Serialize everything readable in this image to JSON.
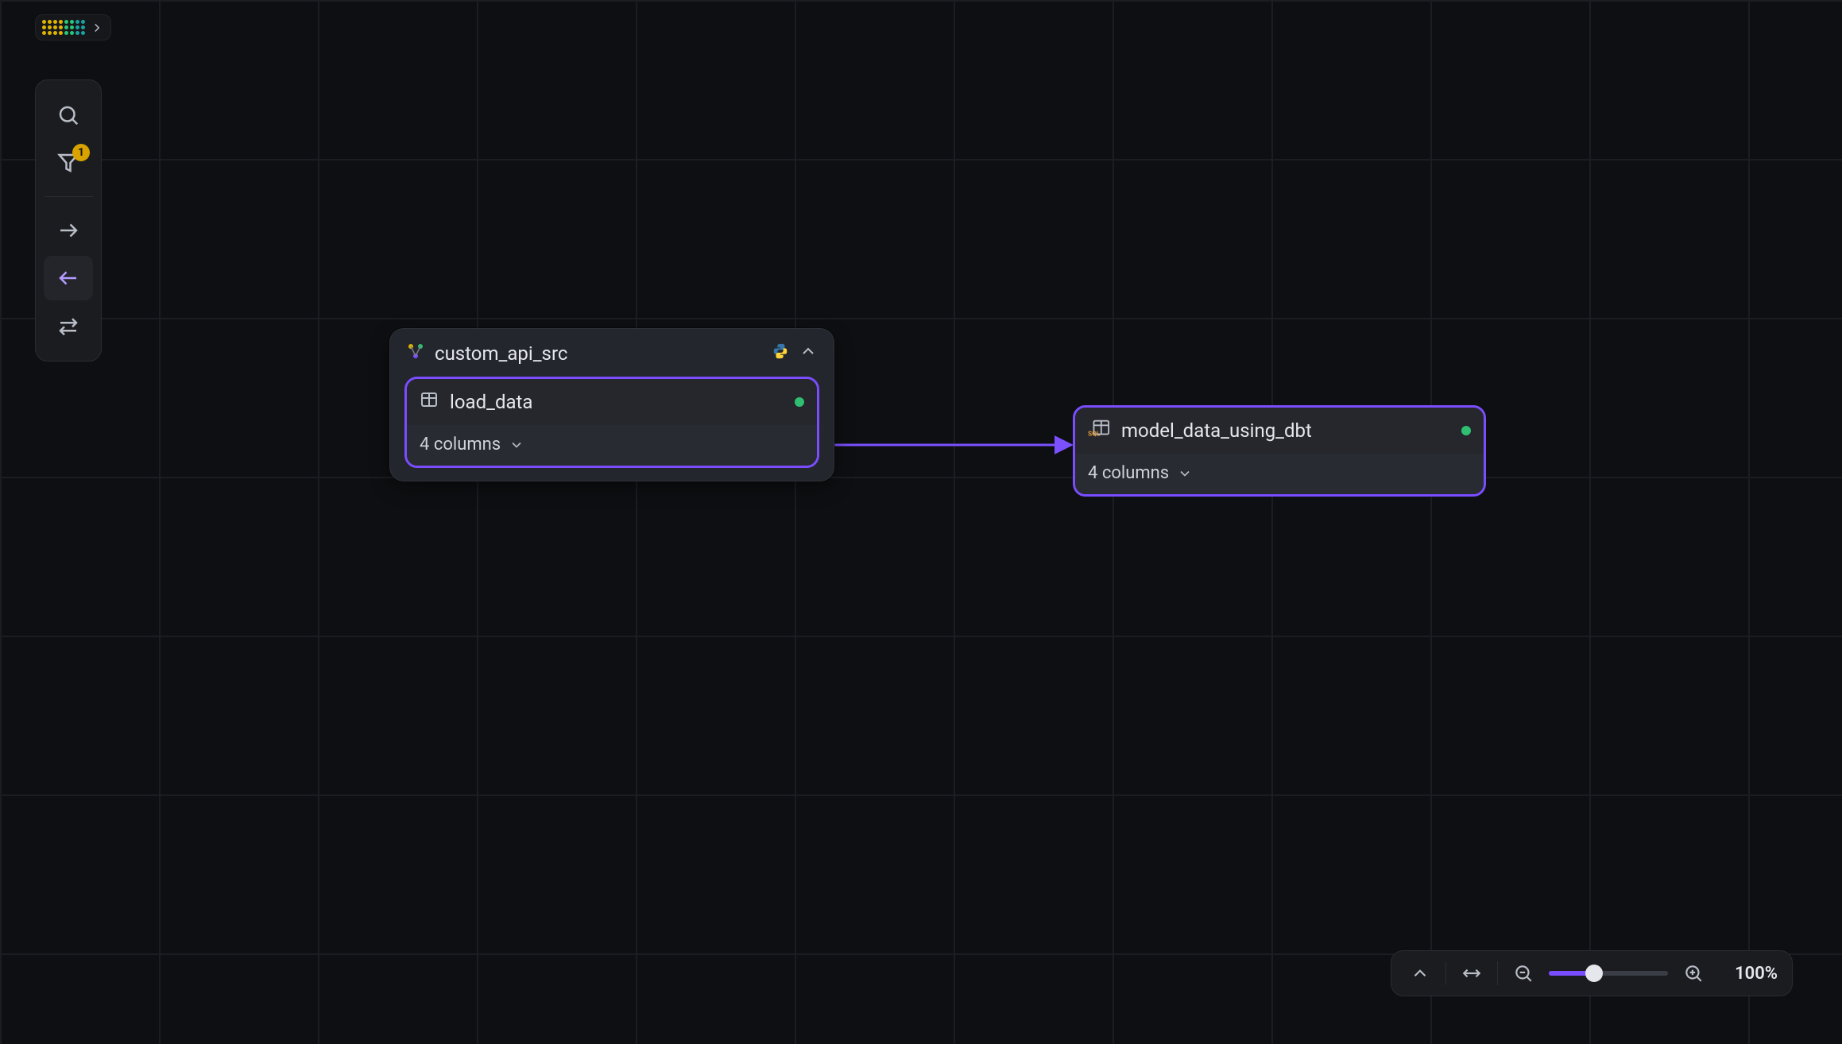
{
  "toolbar": {
    "filter_badge": "1"
  },
  "group": {
    "title": "custom_api_src",
    "lang_icon": "python",
    "inner": {
      "title": "load_data",
      "columns_label": "4 columns",
      "status": "ok"
    }
  },
  "node2": {
    "title": "model_data_using_dbt",
    "columns_label": "4 columns",
    "status": "ok",
    "kind": "sql"
  },
  "zoom": {
    "percent_label": "100%",
    "percent_value": 100
  }
}
